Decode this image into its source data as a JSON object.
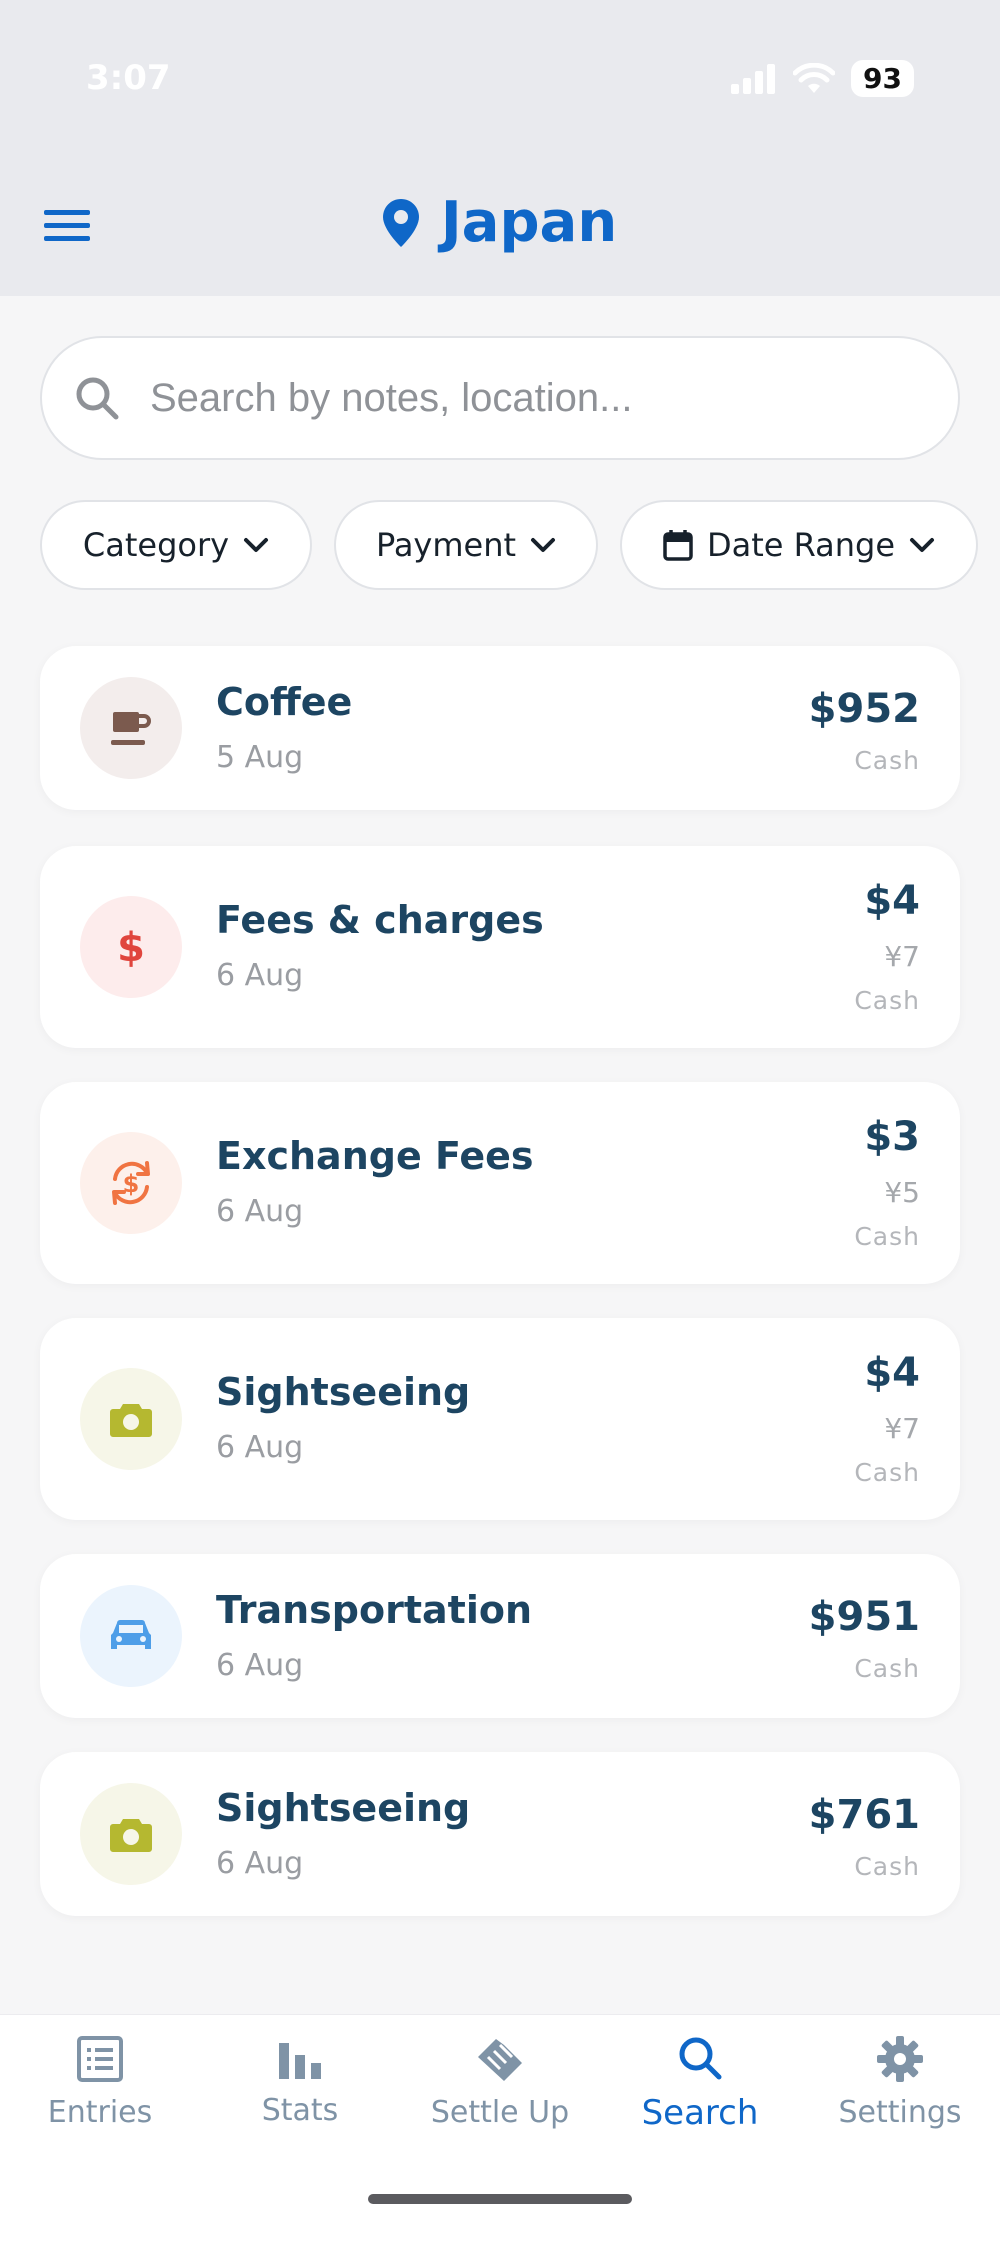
{
  "status_bar": {
    "time": "3:07",
    "battery": "93"
  },
  "header": {
    "title": "Japan"
  },
  "search": {
    "placeholder": "Search by notes, location..."
  },
  "filters": {
    "category": "Category",
    "payment": "Payment",
    "date_range": "Date Range"
  },
  "entries": [
    {
      "name": "Coffee",
      "date": "5 Aug",
      "amount": "$952",
      "local": "",
      "payment": "Cash",
      "icon": "coffee-icon",
      "color": "#7b5a4e",
      "bg": "#f3edec"
    },
    {
      "name": "Fees & charges",
      "date": "6 Aug",
      "amount": "$4",
      "local": "¥7",
      "payment": "Cash",
      "icon": "dollar-icon",
      "color": "#e0453d",
      "bg": "#fdecec"
    },
    {
      "name": "Exchange Fees",
      "date": "6 Aug",
      "amount": "$3",
      "local": "¥5",
      "payment": "Cash",
      "icon": "exchange-icon",
      "color": "#f07442",
      "bg": "#fdf0eb"
    },
    {
      "name": "Sightseeing",
      "date": "6 Aug",
      "amount": "$4",
      "local": "¥7",
      "payment": "Cash",
      "icon": "camera-icon",
      "color": "#b5b830",
      "bg": "#f6f6e8"
    },
    {
      "name": "Transportation",
      "date": "6 Aug",
      "amount": "$951",
      "local": "",
      "payment": "Cash",
      "icon": "car-icon",
      "color": "#4e9ee8",
      "bg": "#ebf4fd"
    },
    {
      "name": "Sightseeing",
      "date": "6 Aug",
      "amount": "$761",
      "local": "",
      "payment": "Cash",
      "icon": "camera-icon",
      "color": "#b5b830",
      "bg": "#f6f6e8"
    }
  ],
  "tabs": [
    {
      "label": "Entries",
      "icon": "list-icon"
    },
    {
      "label": "Stats",
      "icon": "bar-chart-icon"
    },
    {
      "label": "Settle Up",
      "icon": "handshake-icon"
    },
    {
      "label": "Search",
      "icon": "search-icon",
      "active": true
    },
    {
      "label": "Settings",
      "icon": "gear-icon"
    }
  ],
  "colors": {
    "accent": "#0f67c8",
    "text": "#1d4562",
    "muted": "#9a9da2"
  }
}
